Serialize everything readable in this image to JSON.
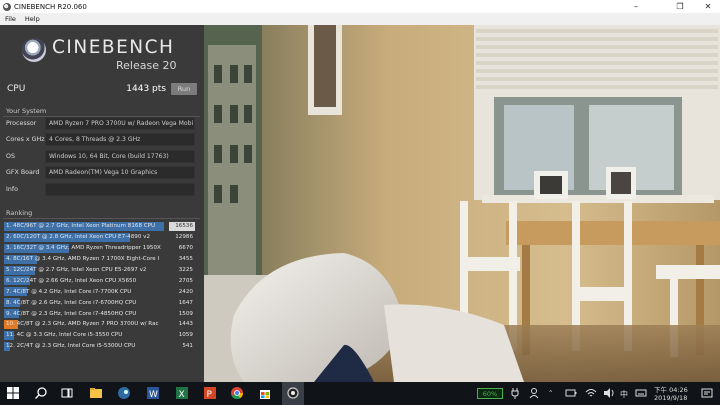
{
  "window": {
    "title": "CINEBENCH R20.060",
    "minimize": "–",
    "maximize": "❐",
    "close": "✕"
  },
  "menu": {
    "file": "File",
    "help": "Help"
  },
  "logo": {
    "name": "CINEBENCH",
    "release": "Release 20"
  },
  "cpu": {
    "label": "CPU",
    "score": "1443 pts",
    "run_label": "Run"
  },
  "system": {
    "header": "Your System",
    "rows": [
      {
        "key": "Processor",
        "value": "AMD Ryzen 7 PRO 3700U w/ Radeon Vega Mobi"
      },
      {
        "key": "Cores x GHz",
        "value": "4 Cores, 8 Threads @ 2.3 GHz"
      },
      {
        "key": "OS",
        "value": "Windows 10, 64 Bit, Core (build 17763)"
      },
      {
        "key": "GFX Board",
        "value": "AMD Radeon(TM) Vega 10 Graphics"
      },
      {
        "key": "Info",
        "value": ""
      }
    ]
  },
  "ranking": {
    "header": "Ranking",
    "max_score": 16536,
    "rows": [
      {
        "label": "1. 48C/96T @ 2.7 GHz, Intel Xeon Platinum 8168 CPU",
        "score": "16536",
        "value": 16536,
        "highlight": "first"
      },
      {
        "label": "2. 60C/120T @ 2.8 GHz, Intel Xeon CPU E7-4890 v2",
        "score": "12986",
        "value": 12986
      },
      {
        "label": "3. 16C/32T @ 3.4 GHz, AMD Ryzen Threadripper 1950X",
        "score": "6670",
        "value": 6670
      },
      {
        "label": "4. 8C/16T @ 3.4 GHz, AMD Ryzen 7 1700X Eight-Core I",
        "score": "3455",
        "value": 3455
      },
      {
        "label": "5. 12C/24T @ 2.7 GHz, Intel Xeon CPU E5-2697 v2",
        "score": "3225",
        "value": 3225
      },
      {
        "label": "6. 12C/24T @ 2.66 GHz, Intel Xeon CPU X5650",
        "score": "2705",
        "value": 2705
      },
      {
        "label": "7. 4C/8T @ 4.2 GHz, Intel Core i7-7700K CPU",
        "score": "2420",
        "value": 2420
      },
      {
        "label": "8. 4C/8T @ 2.6 GHz, Intel Core i7-6700HQ CPU",
        "score": "1647",
        "value": 1647
      },
      {
        "label": "9. 4C/8T @ 2.3 GHz, Intel Core i7-4850HQ CPU",
        "score": "1509",
        "value": 1509
      },
      {
        "label": "10. 4C/8T @ 2.3 GHz, AMD Ryzen 7 PRO 3700U w/ Rac",
        "score": "1443",
        "value": 1443,
        "highlight": "current"
      },
      {
        "label": "11. 4C @ 3.3 GHz, Intel Core i5-3550 CPU",
        "score": "1059",
        "value": 1059
      },
      {
        "label": "12. 2C/4T @ 2.3 GHz, Intel Core i5-5300U CPU",
        "score": "541",
        "value": 541
      }
    ]
  },
  "taskbar": {
    "battery": "60%",
    "ime": "中",
    "time": "下午 04:26",
    "date": "2019/9/18"
  },
  "colors": {
    "bar_blue": "#3d6fa8",
    "bar_current": "#e07a27",
    "panel": "#3a3a3a"
  }
}
